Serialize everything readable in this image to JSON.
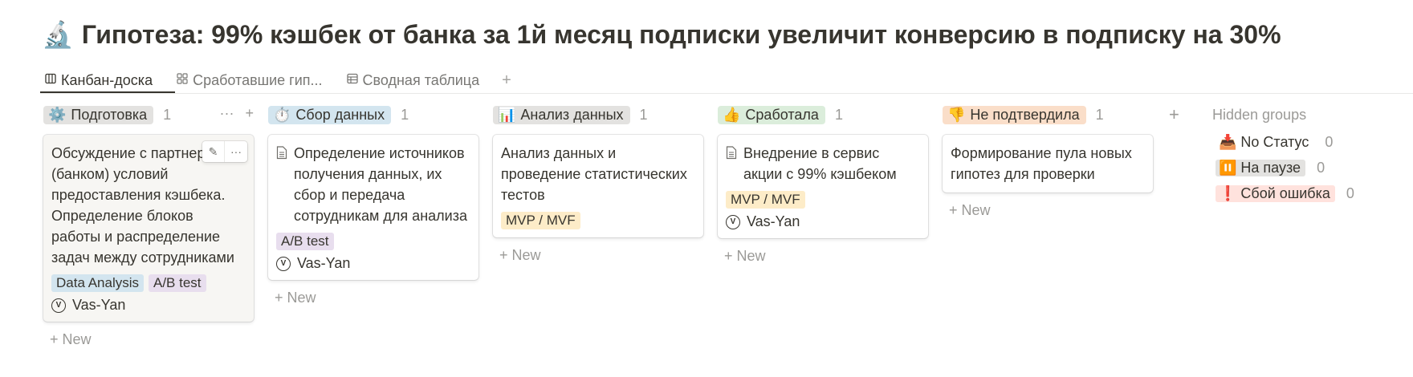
{
  "page": {
    "emoji": "🔬",
    "title": "Гипотеза: 99% кэшбек от банка за 1й месяц подписки увеличит конверсию в подписку на 30%"
  },
  "tabs": [
    {
      "icon": "▯▯",
      "label": "Канбан-доска",
      "active": true
    },
    {
      "icon": "⊞",
      "label": "Сработавшие гип..."
    },
    {
      "icon": "▤",
      "label": "Сводная таблица"
    }
  ],
  "tab_add": "+",
  "columns": [
    {
      "emoji": "⚙️",
      "label": "Подготовка",
      "count": "1",
      "color": "#e3e2e0",
      "actions": {
        "more": "···",
        "add": "+"
      },
      "cards": [
        {
          "title": "Обсуждение с партнерами (банком) условий предоставления кэшбека. Определение блоков работы и распределение задач между сотрудниками",
          "tags": [
            {
              "label": "Data Analysis",
              "color": "#d3e5ef"
            },
            {
              "label": "A/B test",
              "color": "#e8deee"
            }
          ],
          "person": "Vas-Yan",
          "hover_tools": {
            "edit": "✎",
            "more": "···"
          }
        }
      ],
      "new_label": "+ New"
    },
    {
      "emoji": "⏱️",
      "label": "Сбор данных",
      "count": "1",
      "color": "#d3e5ef",
      "cards": [
        {
          "title": "Определение источников получения данных, их сбор и передача сотрудникам для анализа",
          "tags": [
            {
              "label": "A/B test",
              "color": "#e8deee"
            }
          ],
          "person": "Vas-Yan"
        }
      ],
      "new_label": "+ New"
    },
    {
      "emoji": "📊",
      "label": "Анализ данных",
      "count": "1",
      "color": "#e3e2e0",
      "cards": [
        {
          "title": "Анализ данных и проведение статистических тестов",
          "tags": [
            {
              "label": "MVP / MVF",
              "color": "#fdecc8"
            }
          ]
        }
      ],
      "new_label": "+ New"
    },
    {
      "emoji": "👍",
      "label": "Сработала",
      "count": "1",
      "color": "#dbeddb",
      "cards": [
        {
          "title": "Внедрение в сервис акции с 99% кэшбеком",
          "tags": [
            {
              "label": "MVP / MVF",
              "color": "#fdecc8"
            }
          ],
          "person": "Vas-Yan"
        }
      ],
      "new_label": "+ New"
    },
    {
      "emoji": "👎",
      "label": "Не подтвердила",
      "count": "1",
      "color": "#fadec9",
      "cards": [
        {
          "title": "Формирование пула новых гипотез для проверки"
        }
      ],
      "new_label": "+ New"
    }
  ],
  "add_group": "+",
  "hidden_groups": {
    "title": "Hidden groups",
    "items": [
      {
        "emoji": "📥",
        "label": "No Статус",
        "count": "0",
        "color": "transparent"
      },
      {
        "emoji": "⏸️",
        "label": "На паузе",
        "count": "0",
        "color": "#e3e2e0"
      },
      {
        "emoji": "❗",
        "label": "Сбой ошибка",
        "count": "0",
        "color": "#ffe2dd"
      }
    ]
  }
}
